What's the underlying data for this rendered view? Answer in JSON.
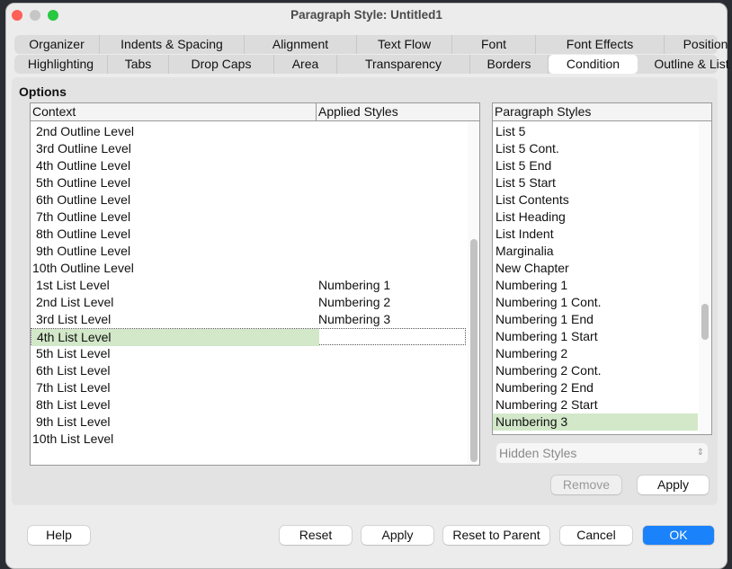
{
  "window": {
    "title": "Paragraph Style: Untitled1"
  },
  "tabs_row1": [
    "Organizer",
    "Indents & Spacing",
    "Alignment",
    "Text Flow",
    "Font",
    "Font Effects",
    "Position"
  ],
  "tabs_row2": [
    "Highlighting",
    "Tabs",
    "Drop Caps",
    "Area",
    "Transparency",
    "Borders",
    "Condition",
    "Outline & List"
  ],
  "selected_tab": "Condition",
  "options_label": "Options",
  "context_table": {
    "headers": [
      "Context",
      "Applied Styles"
    ],
    "rows": [
      [
        "2nd Outline Level",
        ""
      ],
      [
        "3rd Outline Level",
        ""
      ],
      [
        "4th Outline Level",
        ""
      ],
      [
        "5th Outline Level",
        ""
      ],
      [
        "6th Outline Level",
        ""
      ],
      [
        "7th Outline Level",
        ""
      ],
      [
        "8th Outline Level",
        ""
      ],
      [
        "9th Outline Level",
        ""
      ],
      [
        "10th Outline Level",
        ""
      ],
      [
        "1st List Level",
        "Numbering 1"
      ],
      [
        "2nd List Level",
        "Numbering 2"
      ],
      [
        "3rd List Level",
        "Numbering 3"
      ],
      [
        "4th List Level",
        ""
      ],
      [
        "5th List Level",
        ""
      ],
      [
        "6th List Level",
        ""
      ],
      [
        "7th List Level",
        ""
      ],
      [
        "8th List Level",
        ""
      ],
      [
        "9th List Level",
        ""
      ],
      [
        "10th List Level",
        ""
      ]
    ],
    "selected_row": "4th List Level"
  },
  "paragraph_styles": {
    "header": "Paragraph Styles",
    "items": [
      "List 5",
      "List 5 Cont.",
      "List 5 End",
      "List 5 Start",
      "List Contents",
      "List Heading",
      "List Indent",
      "Marginalia",
      "New Chapter",
      "Numbering 1",
      "Numbering 1 Cont.",
      "Numbering 1 End",
      "Numbering 1 Start",
      "Numbering 2",
      "Numbering 2 Cont.",
      "Numbering 2 End",
      "Numbering 2 Start",
      "Numbering 3"
    ],
    "selected": "Numbering 3"
  },
  "filter_select": {
    "value": "Hidden Styles"
  },
  "buttons": {
    "remove": "Remove",
    "apply_condition": "Apply",
    "help": "Help",
    "reset": "Reset",
    "apply": "Apply",
    "reset_to_parent": "Reset to Parent",
    "cancel": "Cancel",
    "ok": "OK"
  },
  "colors": {
    "selection": "#d2e8c9",
    "ok_button": "#1a82fb",
    "close": "#fe5f57",
    "minimize": "#c6c6c6",
    "zoom": "#28c840"
  }
}
